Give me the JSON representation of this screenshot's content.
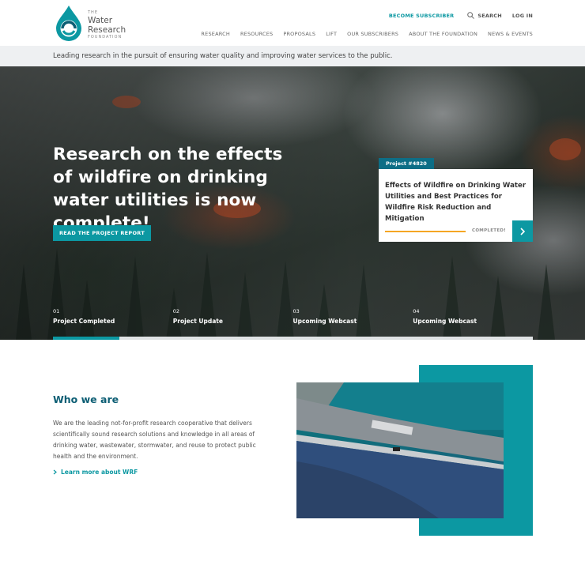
{
  "header": {
    "logo": {
      "the": "THE",
      "line1": "Water",
      "line2": "Research",
      "foundation": "FOUNDATION"
    },
    "top_links": {
      "subscribe": "BECOME SUBSCRIBER",
      "search": "SEARCH",
      "login": "LOG IN"
    },
    "nav": [
      "RESEARCH",
      "RESOURCES",
      "PROPOSALS",
      "LIFT",
      "OUR SUBSCRIBERS",
      "ABOUT THE FOUNDATION",
      "NEWS & EVENTS"
    ]
  },
  "tagline": "Leading research in the pursuit of ensuring water quality and improving water services to the public.",
  "hero": {
    "title": "Research on the effects of wildfire on drinking water utilities is now complete!",
    "cta": "READ THE PROJECT REPORT",
    "project": {
      "tag": "Project  #4820",
      "title": "Effects of Wildfire on Drinking Water Utilities and Best Practices for Wildfire Risk Reduction and Mitigation",
      "status": "COMPLETED!",
      "progress": 1.0,
      "progress_color": "#f5a623"
    },
    "slides": [
      {
        "num": "01",
        "label": "Project Completed"
      },
      {
        "num": "02",
        "label": "Project Update"
      },
      {
        "num": "03",
        "label": "Upcoming Webcast"
      },
      {
        "num": "04",
        "label": "Upcoming Webcast"
      }
    ],
    "active_slide": 0
  },
  "who": {
    "title": "Who we are",
    "body": "We are the leading not-for-profit research cooperative that delivers scientifically sound research solutions and knowledge in all areas of drinking water, wastewater, stormwater, and reuse to protect public health and the environment.",
    "link": "Learn more about WRF"
  },
  "colors": {
    "accent": "#0c98a2",
    "dark_teal": "#0d5e74",
    "tag_bg": "#0d6e86"
  },
  "icons": {
    "search": "search-icon",
    "next": "chevron-right-icon",
    "link": "chevron-right-icon"
  }
}
